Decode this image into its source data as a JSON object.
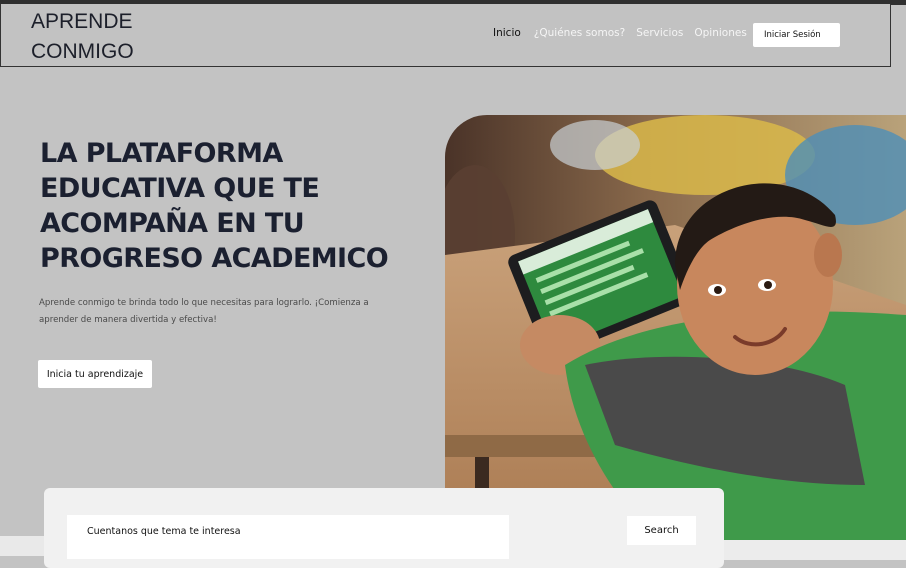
{
  "header": {
    "logo_line1": "APRENDE",
    "logo_line2": "CONMIGO",
    "nav": [
      {
        "label": "Inicio",
        "active": true
      },
      {
        "label": "¿Quiénes somos?",
        "active": false
      },
      {
        "label": "Servicios",
        "active": false
      },
      {
        "label": "Opiniones",
        "active": false
      }
    ],
    "login_label": "Iniciar Sesión"
  },
  "hero": {
    "title": "LA PLATAFORMA EDUCATIVA QUE TE ACOMPAÑA EN TU PROGRESO ACADEMICO",
    "subtitle": "Aprende conmigo te brinda todo lo que necesitas para lograrlo. ¡Comienza a aprender de manera divertida y efectiva!",
    "cta_label": "Inicia tu aprendizaje"
  },
  "search": {
    "placeholder": "Cuentanos que tema te interesa",
    "button_label": "Search"
  },
  "colors": {
    "background": "#c3c3c3",
    "heading": "#1b2030",
    "button_bg": "#ffffff",
    "panel": "#f1f1f1"
  }
}
